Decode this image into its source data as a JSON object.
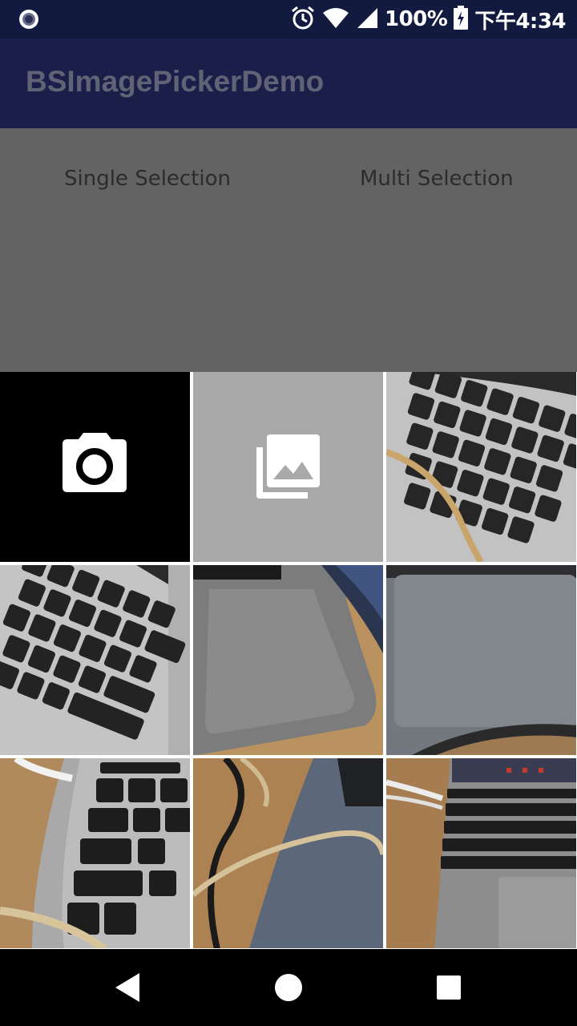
{
  "status_bar": {
    "battery": "100%",
    "time": "下午4:34",
    "icons": [
      "record-icon",
      "alarm-icon",
      "wifi-icon",
      "signal-icon",
      "battery-charging-icon"
    ]
  },
  "app": {
    "title": "BSImagePickerDemo"
  },
  "buttons": {
    "single": "Single Selection",
    "multi": "Multi Selection"
  },
  "picker": {
    "tiles": [
      {
        "kind": "camera",
        "icon": "camera-icon"
      },
      {
        "kind": "gallery",
        "icon": "gallery-icon"
      },
      {
        "kind": "photo"
      },
      {
        "kind": "photo"
      },
      {
        "kind": "photo"
      },
      {
        "kind": "photo"
      },
      {
        "kind": "photo"
      },
      {
        "kind": "photo"
      },
      {
        "kind": "photo"
      }
    ]
  },
  "nav_bar": {
    "icons": [
      "back-icon",
      "home-icon",
      "recents-icon"
    ]
  },
  "colors": {
    "status_bar": "#131a40",
    "toolbar": "#1a1f4a",
    "scrim": "#636363"
  }
}
